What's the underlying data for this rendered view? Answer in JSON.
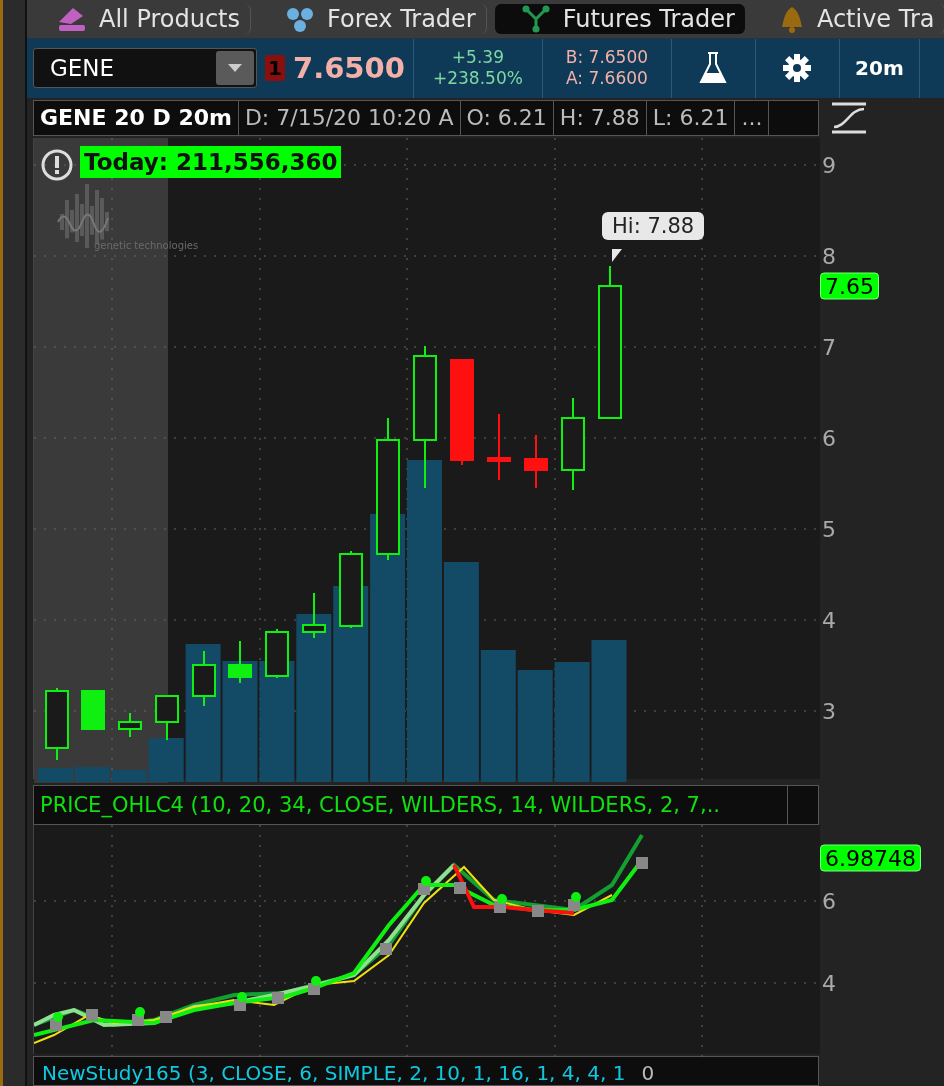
{
  "tabs": [
    {
      "label": "All Products",
      "selected": false
    },
    {
      "label": "Forex Trader",
      "selected": false
    },
    {
      "label": "Futures Trader",
      "selected": true
    },
    {
      "label": "Active Tra",
      "selected": false
    }
  ],
  "toolbar": {
    "symbol": "GENE",
    "alert_count": "1",
    "last": "7.6500",
    "change": "+5.39",
    "change_pct": "+238.50%",
    "bid": "B: 7.6500",
    "ask": "A: 7.6600",
    "interval": "20m"
  },
  "chart_header": {
    "title": "GENE 20 D 20m",
    "fields": [
      "D: 7/15/20 10:20 A",
      "O: 6.21",
      "H: 7.88",
      "L: 6.21",
      "..."
    ]
  },
  "price_chart": {
    "volume_label": "Today: 211,556,360",
    "logo_text": "genetic technologies",
    "high_bubble": "Hi: 7.88",
    "last_label": "7.65",
    "axis_ticks": [
      "9",
      "8",
      "7",
      "6",
      "5",
      "4",
      "3"
    ]
  },
  "study": {
    "title": "PRICE_OHLC4 (10, 20, 34, CLOSE, WILDERS, 14, WILDERS, 2, 7,..",
    "last_label": "6.98748",
    "axis_ticks": [
      "6",
      "4"
    ]
  },
  "bottom_study": {
    "title": "NewStudy165 (3, CLOSE, 6, SIMPLE, 2, 10, 1, 16, 1, 4, 4, 1",
    "value": "0"
  }
}
